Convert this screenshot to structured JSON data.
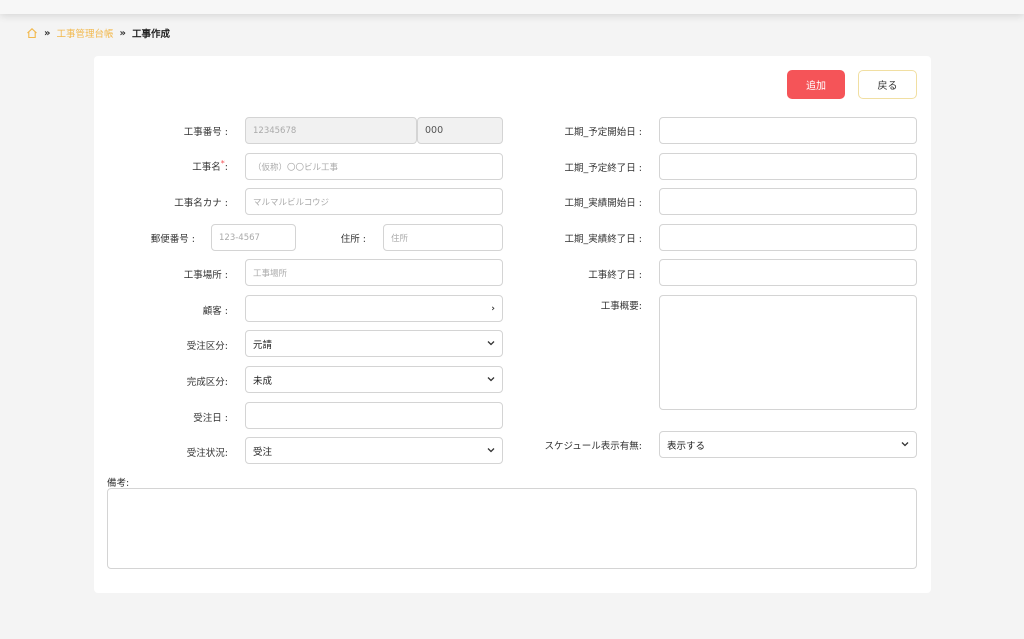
{
  "breadcrumb": {
    "link": "工事管理台帳",
    "separator": "»",
    "current": "工事作成"
  },
  "actions": {
    "add": "追加",
    "back": "戻る"
  },
  "form": {
    "koji_bango": {
      "label": "工事番号 :",
      "placeholder": "12345678",
      "suffix": "000"
    },
    "koji_mei": {
      "label": "工事名",
      "label_suffix": ":",
      "required_mark": "*",
      "placeholder": "（仮称）〇〇ビル工事"
    },
    "koji_mei_kana": {
      "label": "工事名カナ :",
      "placeholder": "マルマルビルコウジ"
    },
    "yubin": {
      "label": "郵便番号 :",
      "placeholder": "123-4567"
    },
    "jusho": {
      "label": "住所 :",
      "placeholder": "住所"
    },
    "koji_basho": {
      "label": "工事場所 :",
      "placeholder": "工事場所"
    },
    "kokyaku": {
      "label": "顧客 :",
      "value": "",
      "chevron": "›"
    },
    "juchu_kubun": {
      "label": "受注区分:",
      "value": "元請"
    },
    "kansei_kubun": {
      "label": "完成区分:",
      "value": "未成"
    },
    "juchu_bi": {
      "label": "受注日 :",
      "value": ""
    },
    "juchu_jokyo": {
      "label": "受注状況:",
      "value": "受注"
    },
    "yotei_kaishi": {
      "label": "工期_予定開始日 :"
    },
    "yotei_shuryo": {
      "label": "工期_予定終了日 :"
    },
    "jisseki_kaishi": {
      "label": "工期_実績開始日 :"
    },
    "jisseki_shuryo": {
      "label": "工期_実績終了日 :"
    },
    "koji_shuryo": {
      "label": "工事終了日 :"
    },
    "koji_gaiyo": {
      "label": "工事概要:"
    },
    "schedule": {
      "label": "スケジュール表示有無:",
      "value": "表示する"
    },
    "biko": {
      "label": "備考:"
    }
  },
  "colors": {
    "accent": "#f2b84b",
    "primary_button": "#f55458"
  }
}
